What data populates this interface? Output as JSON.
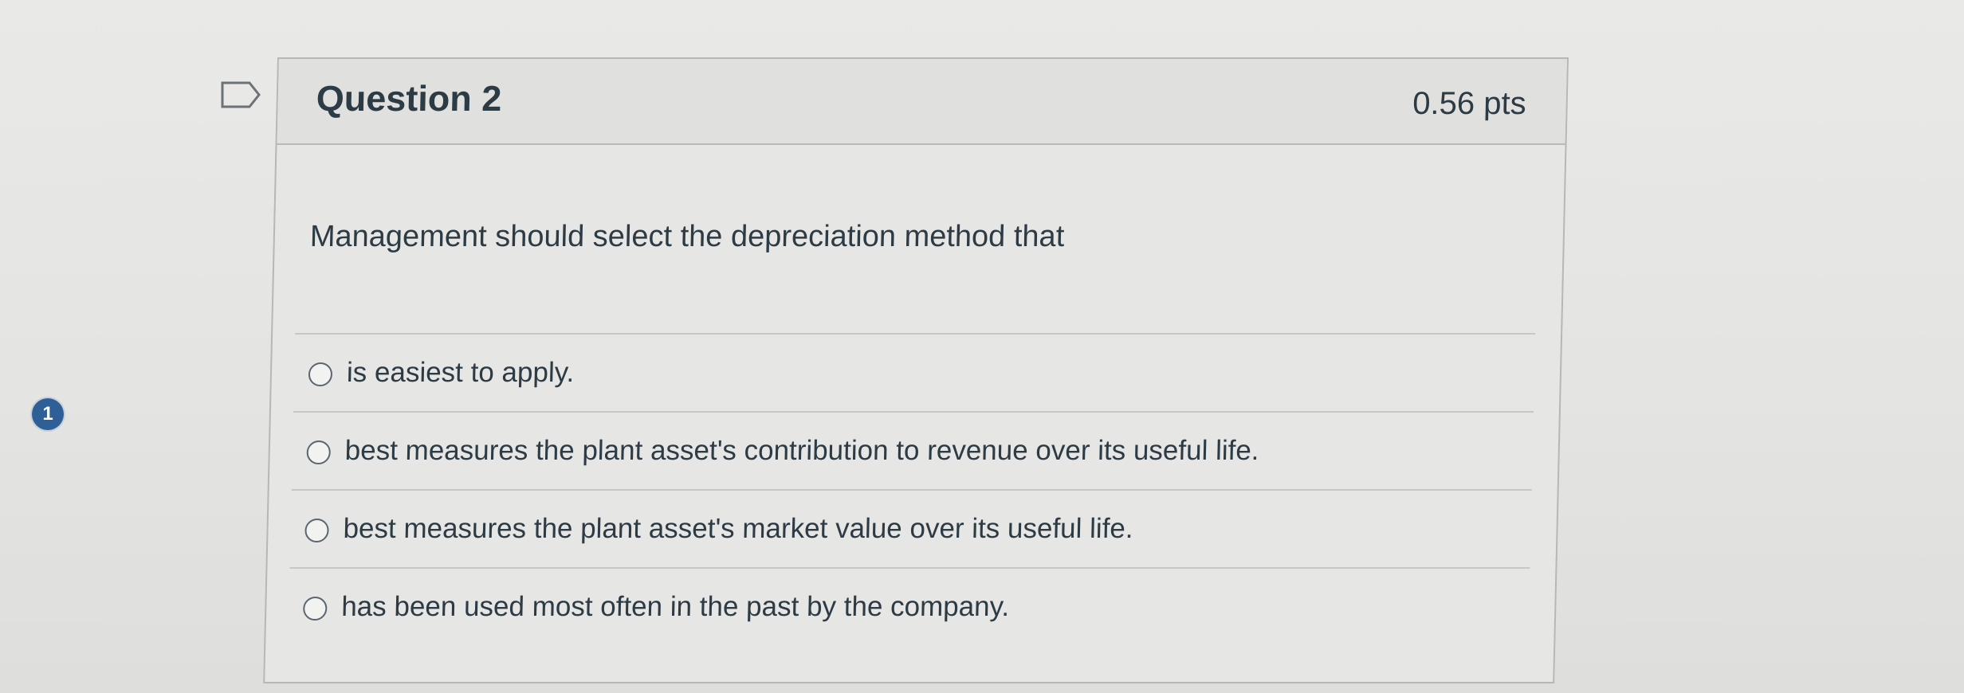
{
  "badge": {
    "value": "1"
  },
  "question": {
    "title": "Question 2",
    "points": "0.56 pts",
    "text": "Management should select the depreciation method that"
  },
  "answers": [
    {
      "label": "is easiest to apply."
    },
    {
      "label": "best measures the plant asset's contribution to revenue over its useful life."
    },
    {
      "label": "best measures the plant asset's market value over its useful life."
    },
    {
      "label": "has been used most often in the past by the company."
    }
  ],
  "colors": {
    "accent": "#2f5f97",
    "text": "#2d3b45",
    "border": "#b7b8b6"
  },
  "icons": {
    "flag": "flag-icon",
    "radio": "radio-button-icon"
  }
}
